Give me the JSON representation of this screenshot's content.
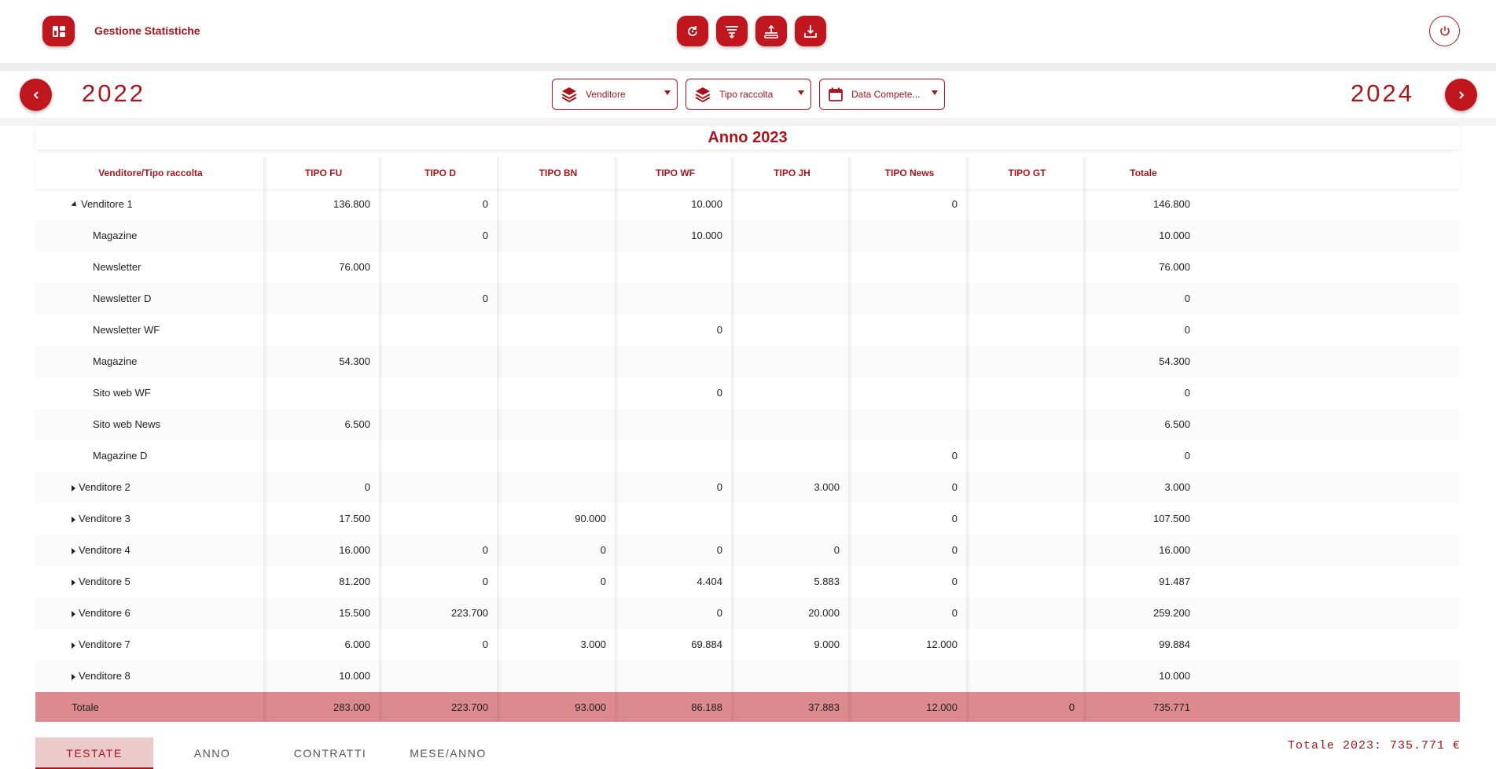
{
  "header": {
    "title": "Gestione Statistiche",
    "logo_icon": "dashboard-icon",
    "toolbar": [
      {
        "name": "refresh-button",
        "icon": "refresh-icon"
      },
      {
        "name": "filter-download-button",
        "icon": "filter-icon"
      },
      {
        "name": "upload-button",
        "icon": "upload-icon"
      },
      {
        "name": "download-button",
        "icon": "download-icon"
      }
    ],
    "power_icon": "power-icon"
  },
  "yearbar": {
    "prev_year": "2022",
    "next_year": "2024",
    "filters": [
      {
        "label": "Venditore",
        "icon": "layers-icon"
      },
      {
        "label": "Tipo raccolta",
        "icon": "layers-icon"
      },
      {
        "label": "Data Compete...",
        "icon": "calendar-icon"
      }
    ]
  },
  "table": {
    "title": "Anno 2023",
    "columns": [
      "Venditore/Tipo raccolta",
      "TIPO FU",
      "TIPO D",
      "TIPO BN",
      "TIPO WF",
      "TIPO JH",
      "TIPO News",
      "TIPO GT",
      "Totale"
    ],
    "rows": [
      {
        "label": "Venditore 1",
        "level": 0,
        "expanded": true,
        "values": [
          "136.800",
          "0",
          "",
          "10.000",
          "",
          "0",
          "",
          "146.800"
        ]
      },
      {
        "label": "Magazine",
        "level": 1,
        "values": [
          "",
          "0",
          "",
          "10.000",
          "",
          "",
          "",
          "10.000"
        ]
      },
      {
        "label": "Newsletter",
        "level": 1,
        "values": [
          "76.000",
          "",
          "",
          "",
          "",
          "",
          "",
          "76.000"
        ]
      },
      {
        "label": "Newsletter D",
        "level": 1,
        "values": [
          "",
          "0",
          "",
          "",
          "",
          "",
          "",
          "0"
        ]
      },
      {
        "label": "Newsletter WF",
        "level": 1,
        "values": [
          "",
          "",
          "",
          "0",
          "",
          "",
          "",
          "0"
        ]
      },
      {
        "label": "Magazine",
        "level": 1,
        "values": [
          "54.300",
          "",
          "",
          "",
          "",
          "",
          "",
          "54.300"
        ]
      },
      {
        "label": "Sito web WF",
        "level": 1,
        "values": [
          "",
          "",
          "",
          "0",
          "",
          "",
          "",
          "0"
        ]
      },
      {
        "label": "Sito web News",
        "level": 1,
        "values": [
          "6.500",
          "",
          "",
          "",
          "",
          "",
          "",
          "6.500"
        ]
      },
      {
        "label": "Magazine D",
        "level": 1,
        "values": [
          "",
          "",
          "",
          "",
          "",
          "0",
          "",
          "0"
        ]
      },
      {
        "label": "Venditore 2",
        "level": 0,
        "expanded": false,
        "values": [
          "0",
          "",
          "",
          "0",
          "3.000",
          "0",
          "",
          "3.000"
        ]
      },
      {
        "label": "Venditore 3",
        "level": 0,
        "expanded": false,
        "values": [
          "17.500",
          "",
          "90.000",
          "",
          "",
          "0",
          "",
          "107.500"
        ]
      },
      {
        "label": "Venditore 4",
        "level": 0,
        "expanded": false,
        "values": [
          "16.000",
          "0",
          "0",
          "0",
          "0",
          "0",
          "",
          "16.000"
        ]
      },
      {
        "label": "Venditore 5",
        "level": 0,
        "expanded": false,
        "values": [
          "81.200",
          "0",
          "0",
          "4.404",
          "5.883",
          "0",
          "",
          "91.487"
        ]
      },
      {
        "label": "Venditore 6",
        "level": 0,
        "expanded": false,
        "values": [
          "15.500",
          "223.700",
          "",
          "0",
          "20.000",
          "0",
          "",
          "259.200"
        ]
      },
      {
        "label": "Venditore 7",
        "level": 0,
        "expanded": false,
        "values": [
          "6.000",
          "0",
          "3.000",
          "69.884",
          "9.000",
          "12.000",
          "",
          "99.884"
        ]
      },
      {
        "label": "Venditore 8",
        "level": 0,
        "expanded": false,
        "values": [
          "10.000",
          "",
          "",
          "",
          "",
          "",
          "",
          "10.000"
        ]
      }
    ],
    "total_row": {
      "label": "Totale",
      "values": [
        "283.000",
        "223.700",
        "93.000",
        "86.188",
        "37.883",
        "12.000",
        "0",
        "735.771"
      ]
    }
  },
  "tabs": [
    {
      "label": "TESTATE",
      "active": true
    },
    {
      "label": "ANNO",
      "active": false
    },
    {
      "label": "CONTRATTI",
      "active": false
    },
    {
      "label": "MESE/ANNO",
      "active": false
    }
  ],
  "footer": {
    "grand_total": "Totale 2023: 735.771 €"
  },
  "colors": {
    "accent": "#c0171f",
    "text_accent": "#a8161c",
    "total_row": "#dc8a8d",
    "active_tab": "#ecc9ca"
  }
}
